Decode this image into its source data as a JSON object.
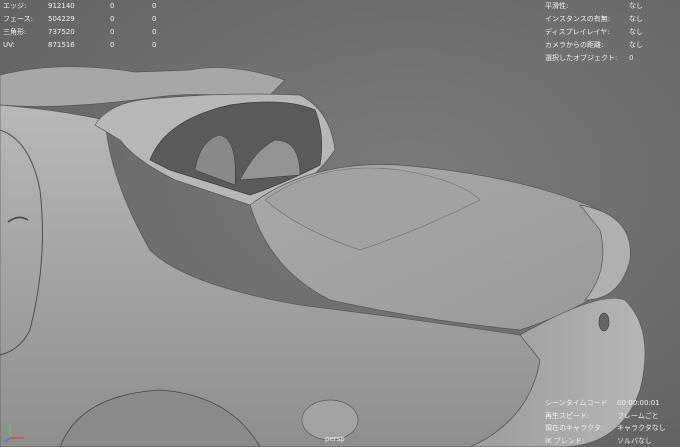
{
  "hud_left": [
    {
      "label": "エッジ:",
      "v1": "912140",
      "v2": "0",
      "v3": "0"
    },
    {
      "label": "フェース:",
      "v1": "504229",
      "v2": "0",
      "v3": "0"
    },
    {
      "label": "三角形:",
      "v1": "737520",
      "v2": "0",
      "v3": "0"
    },
    {
      "label": "UV:",
      "v1": "871516",
      "v2": "0",
      "v3": "0"
    }
  ],
  "hud_right": [
    {
      "key": "平滑性:",
      "value": "なし"
    },
    {
      "key": "インスタンスの有無:",
      "value": "なし"
    },
    {
      "key": "ディスプレイレイヤ:",
      "value": "なし"
    },
    {
      "key": "カメラからの距離:",
      "value": "なし"
    },
    {
      "key": "選択したオブジェクト:",
      "value": "0"
    }
  ],
  "hud_bottom": [
    {
      "key": "シーンタイムコード",
      "value": "00:00:00:01"
    },
    {
      "key": "再生スピード:",
      "value": "フレームごと"
    },
    {
      "key": "現在のキャラクタ:",
      "value": "キャラクタなし"
    },
    {
      "key": "IK ブレンド:",
      "value": "ソルバなし"
    }
  ],
  "camera": "persp",
  "colors": {
    "background": "#6e6e6e",
    "hud_text": "#f2f2f2",
    "axis_x": "#d94a4a",
    "axis_y": "#5fc45f",
    "axis_z": "#4a7ad9"
  }
}
